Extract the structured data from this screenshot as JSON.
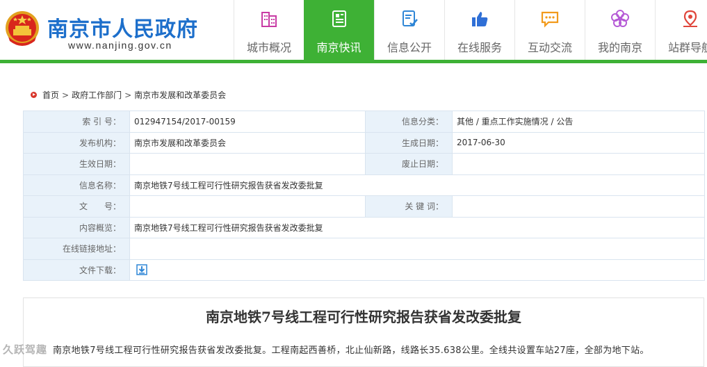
{
  "header": {
    "title": "南京市人民政府",
    "url": "www.nanjing.gov.cn",
    "colors": {
      "brand_blue": "#1d6fcb",
      "accent_green": "#3eb135"
    }
  },
  "nav": [
    {
      "label": "城市概况",
      "icon": "buildings-icon",
      "color": "#c83aa4",
      "active": false
    },
    {
      "label": "南京快讯",
      "icon": "newspaper-icon",
      "color": "#ffffff",
      "active": true
    },
    {
      "label": "信息公开",
      "icon": "document-check-icon",
      "color": "#2f86d6",
      "active": false
    },
    {
      "label": "在线服务",
      "icon": "thumbs-up-icon",
      "color": "#2f6fd6",
      "active": false
    },
    {
      "label": "互动交流",
      "icon": "chat-bubble-icon",
      "color": "#f29a1b",
      "active": false
    },
    {
      "label": "我的南京",
      "icon": "flower-icon",
      "color": "#b55ad6",
      "active": false
    },
    {
      "label": "站群导航",
      "icon": "map-pin-icon",
      "color": "#e0463b",
      "active": false
    }
  ],
  "breadcrumb": {
    "items": [
      "首页",
      "政府工作部门",
      "南京市发展和改革委员会"
    ],
    "separator": ">"
  },
  "info": {
    "index_label": "索 引 号：",
    "index_value": "012947154/2017-00159",
    "category_label": "信息分类：",
    "category_value": "其他 / 重点工作实施情况 / 公告",
    "publisher_label": "发布机构：",
    "publisher_value": "南京市发展和改革委员会",
    "generated_label": "生成日期：",
    "generated_value": "2017-06-30",
    "effective_label": "生效日期：",
    "effective_value": "",
    "expired_label": "废止日期：",
    "expired_value": "",
    "name_label": "信息名称：",
    "name_value": "南京地铁7号线工程可行性研究报告获省发改委批复",
    "docno_label": "文　　号：",
    "docno_value": "",
    "keywords_label": "关 键 词：",
    "keywords_value": "",
    "summary_label": "内容概览：",
    "summary_value": "南京地铁7号线工程可行性研究报告获省发改委批复",
    "link_label": "在线链接地址：",
    "link_value": "",
    "download_label": "文件下载：",
    "download_icon": "download-icon"
  },
  "article": {
    "title": "南京地铁7号线工程可行性研究报告获省发改委批复",
    "body": "南京地铁7号线工程可行性研究报告获省发改委批复。工程南起西善桥，北止仙新路，线路长35.638公里。全线共设置车站27座，全部为地下站。"
  },
  "watermark": "久跃驾趣"
}
